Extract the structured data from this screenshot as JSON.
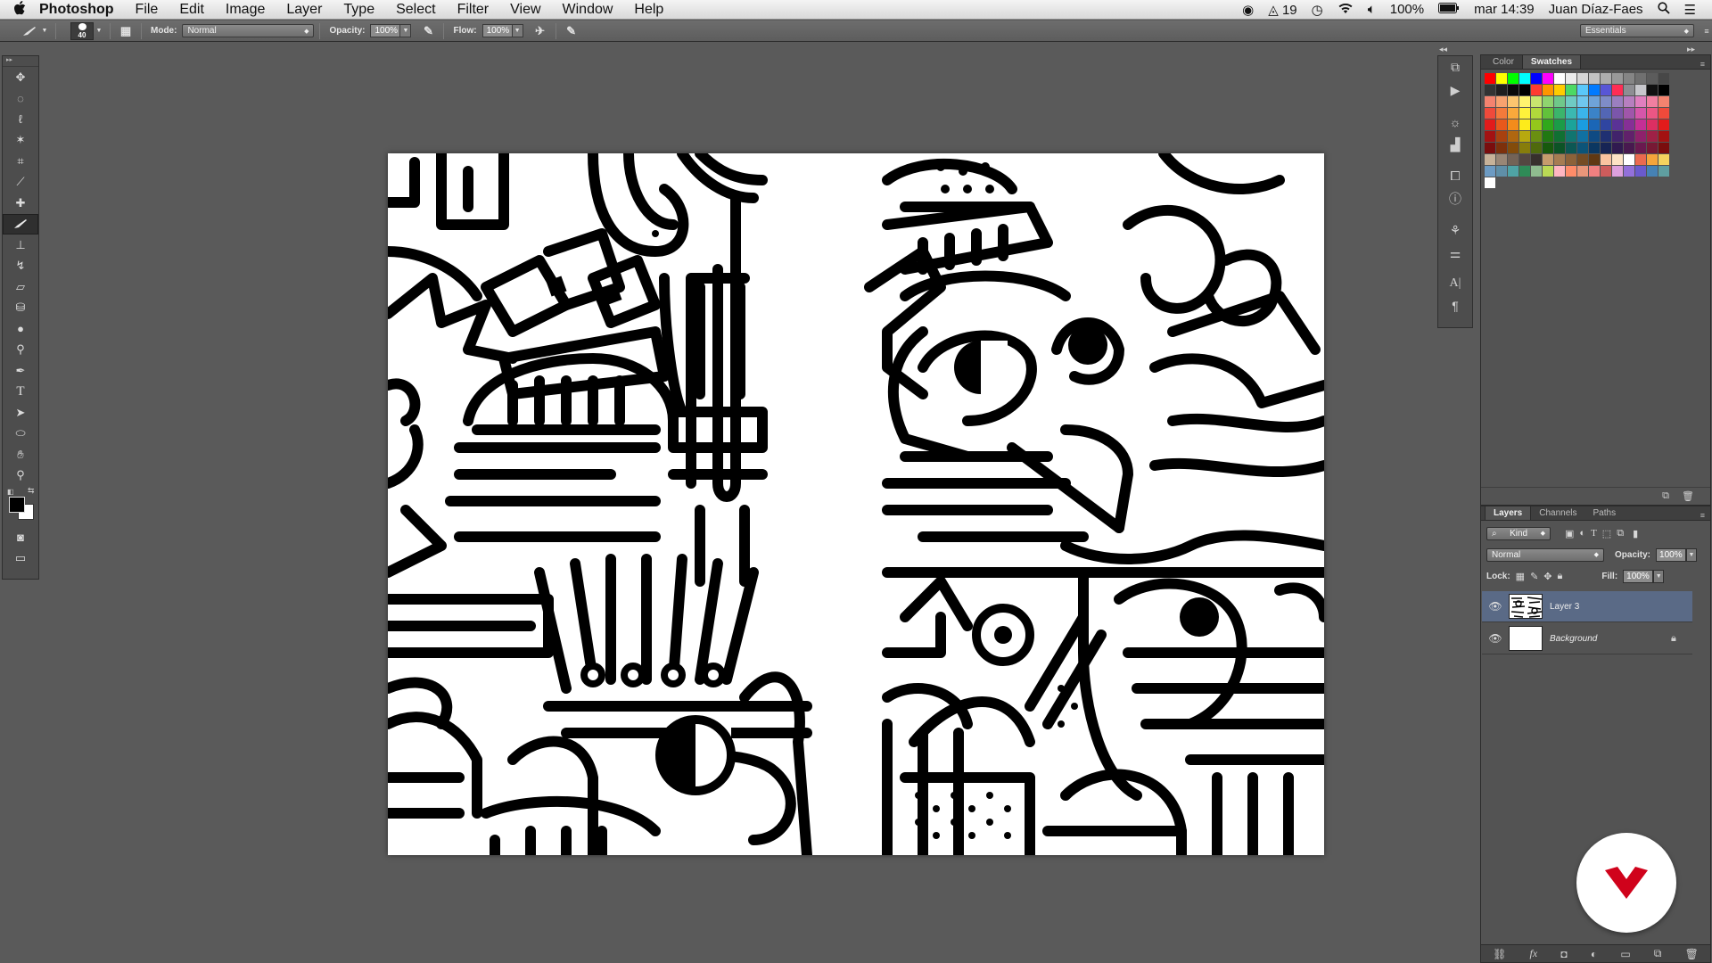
{
  "menubar": {
    "apple_icon": "apple-icon",
    "app_name": "Photoshop",
    "menus": [
      "File",
      "Edit",
      "Image",
      "Layer",
      "Type",
      "Select",
      "Filter",
      "View",
      "Window",
      "Help"
    ],
    "status": {
      "adobe_count": "19",
      "battery": "100%",
      "clock": "mar 14:39",
      "user": "Juan Díaz-Faes"
    }
  },
  "options_bar": {
    "brush_size": "40",
    "mode_label": "Mode:",
    "mode_value": "Normal",
    "opacity_label": "Opacity:",
    "opacity_value": "100%",
    "flow_label": "Flow:",
    "flow_value": "100%",
    "workspace": "Essentials"
  },
  "tools": [
    "move-tool",
    "marquee-tool",
    "lasso-tool",
    "magic-wand-tool",
    "crop-tool",
    "eyedropper-tool",
    "healing-brush-tool",
    "brush-tool",
    "clone-stamp-tool",
    "history-brush-tool",
    "eraser-tool",
    "paint-bucket-tool",
    "blur-tool",
    "dodge-tool",
    "pen-tool",
    "type-tool",
    "path-selection-tool",
    "ellipse-tool",
    "hand-tool",
    "zoom-tool"
  ],
  "active_tool": "brush-tool",
  "colors": {
    "foreground": "#000000",
    "background": "#ffffff",
    "ui_bg": "#5a5a5a",
    "selection": "#5a6a86",
    "brand": "#d0021b"
  },
  "swatches_panel": {
    "tabs": [
      "Color",
      "Swatches"
    ],
    "active_tab": "Swatches"
  },
  "layers_panel": {
    "tabs": [
      "Layers",
      "Channels",
      "Paths"
    ],
    "active_tab": "Layers",
    "filter_kind": "Kind",
    "blend_mode": "Normal",
    "opacity_label": "Opacity:",
    "opacity_value": "100%",
    "lock_label": "Lock:",
    "fill_label": "Fill:",
    "fill_value": "100%",
    "layers": [
      {
        "name": "Layer 3",
        "selected": true,
        "visible": true,
        "locked": false
      },
      {
        "name": "Background",
        "selected": false,
        "visible": true,
        "locked": true
      }
    ]
  }
}
